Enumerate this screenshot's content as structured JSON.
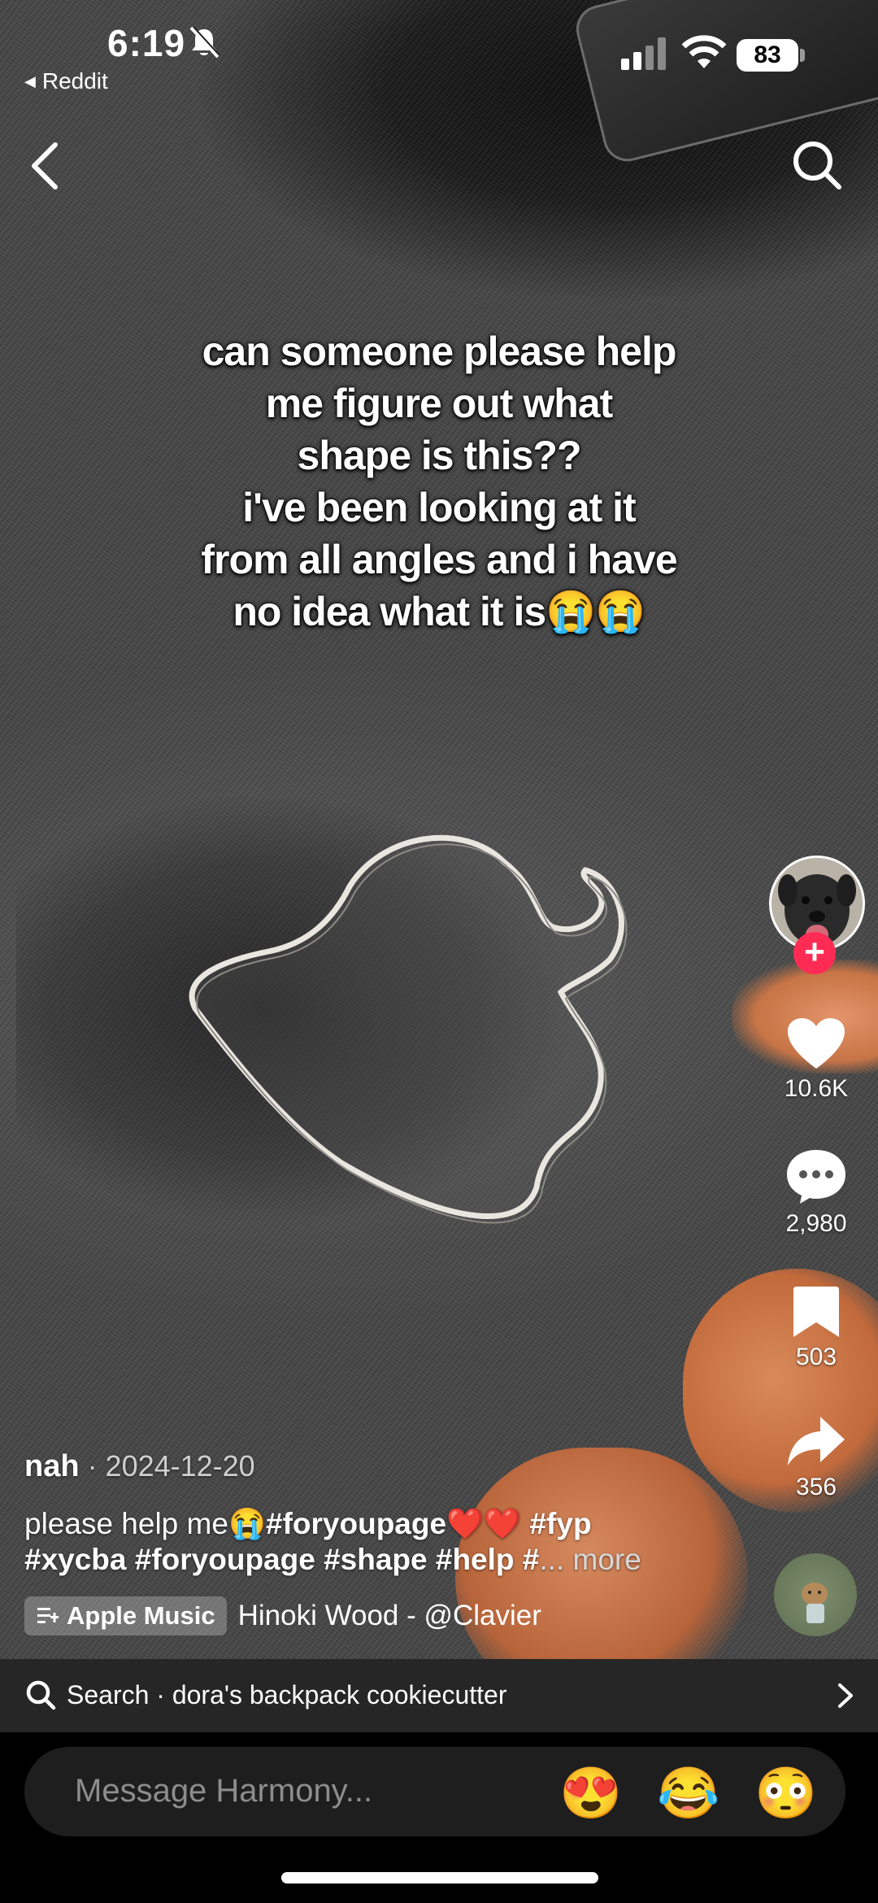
{
  "status_bar": {
    "time": "6:19",
    "back_app": "Reddit",
    "battery": "83"
  },
  "video": {
    "overlay_lines": [
      "can someone please help",
      "me figure out what",
      "shape is this??",
      "i've been looking at it",
      "from all angles and i have",
      "no idea what it is😭😭"
    ]
  },
  "right_rail": {
    "follow_symbol": "+",
    "likes": "10.6K",
    "comments": "2,980",
    "saves": "503",
    "shares": "356"
  },
  "caption": {
    "author": "nah",
    "date": " · 2024-12-20",
    "text": "please help me😭",
    "tags_line1": "#foryoupage❤️❤️ #fyp",
    "tags_line2": "#xycba #foryoupage #shape #help #",
    "more": "... more"
  },
  "music": {
    "badge": "Apple Music",
    "track": "Hinoki Wood - @Clavier"
  },
  "search": {
    "text": "Search · dora's backpack cookiecutter"
  },
  "message": {
    "placeholder": "Message Harmony...",
    "emojis": [
      "😍",
      "😂",
      "😳"
    ]
  },
  "colors": {
    "follow": "#fe2c55",
    "search_bar_bg": "#262626",
    "message_bg": "#1e1e1e"
  }
}
